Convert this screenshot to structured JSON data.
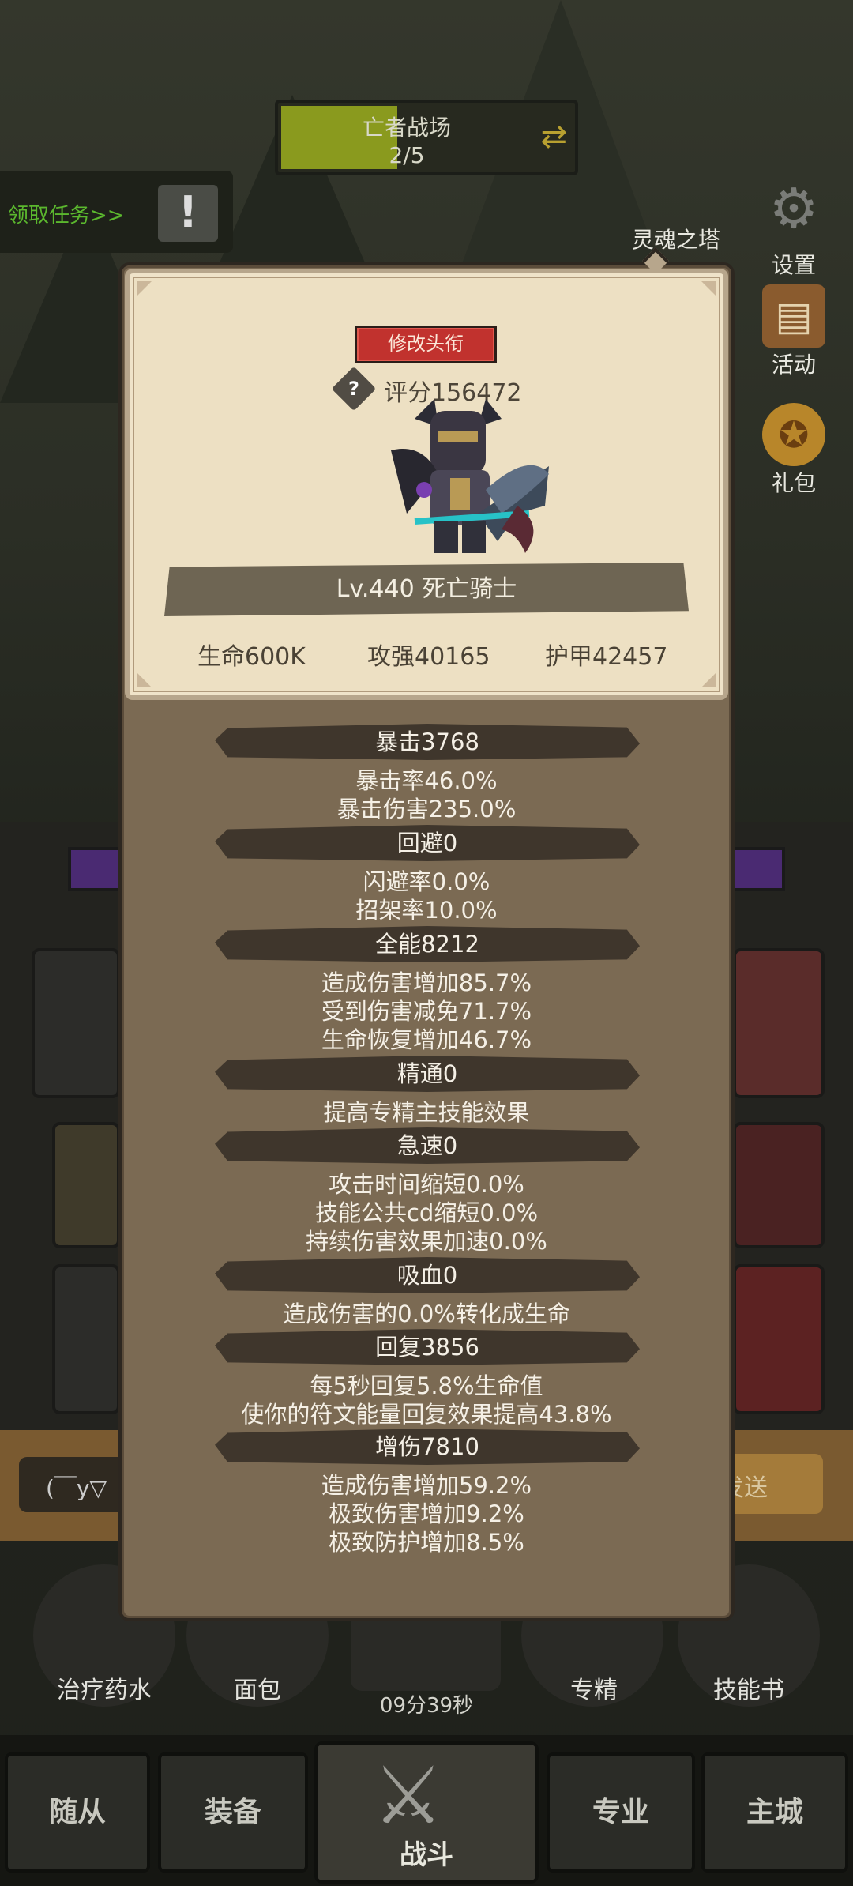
{
  "battle": {
    "title": "亡者战场",
    "progress": "2/5",
    "progress_fraction": 0.4
  },
  "quest": {
    "label": "领取任务>>",
    "alert": "!"
  },
  "side_menu": {
    "settings": "设置",
    "activity": "活动",
    "gift": "礼包",
    "tower": "灵魂之塔"
  },
  "chat": {
    "input_value": "(￣y▽",
    "send": "发送"
  },
  "quick_items": [
    {
      "label": "治疗药水"
    },
    {
      "label": "面包"
    },
    {
      "label": "专精"
    },
    {
      "label": "技能书"
    }
  ],
  "timer": "09分39秒",
  "nav": {
    "tabs": [
      "随从",
      "装备",
      "战斗",
      "专业",
      "主城"
    ],
    "active": "战斗"
  },
  "profile": {
    "change_title_button": "修改头衔",
    "help_icon": "?",
    "score": "评分156472",
    "name": "Lv.440 死亡骑士",
    "hp": "生命600K",
    "attack": "攻强40165",
    "armor": "护甲42457"
  },
  "stats": [
    {
      "header": "暴击3768",
      "lines": [
        "暴击率46.0%",
        "暴击伤害235.0%"
      ]
    },
    {
      "header": "回避0",
      "lines": [
        "闪避率0.0%",
        "招架率10.0%"
      ]
    },
    {
      "header": "全能8212",
      "lines": [
        "造成伤害增加85.7%",
        "受到伤害减免71.7%",
        "生命恢复增加46.7%"
      ]
    },
    {
      "header": "精通0",
      "lines": [
        "提高专精主技能效果"
      ]
    },
    {
      "header": "急速0",
      "lines": [
        "攻击时间缩短0.0%",
        "技能公共cd缩短0.0%",
        "持续伤害效果加速0.0%"
      ]
    },
    {
      "header": "吸血0",
      "lines": [
        "造成伤害的0.0%转化成生命"
      ]
    },
    {
      "header": "回复3856",
      "lines": [
        "每5秒回复5.8%生命值",
        "使你的符文能量回复效果提高43.8%"
      ]
    },
    {
      "header": "增伤7810",
      "lines": [
        "造成伤害增加59.2%",
        "极致伤害增加9.2%",
        "极致防护增加8.5%"
      ]
    }
  ],
  "colors": {
    "accent_red": "#c1322e",
    "card_bg": "#ede0c3",
    "panel_bg": "#7b6a53",
    "quest_green": "#5bb82e"
  }
}
